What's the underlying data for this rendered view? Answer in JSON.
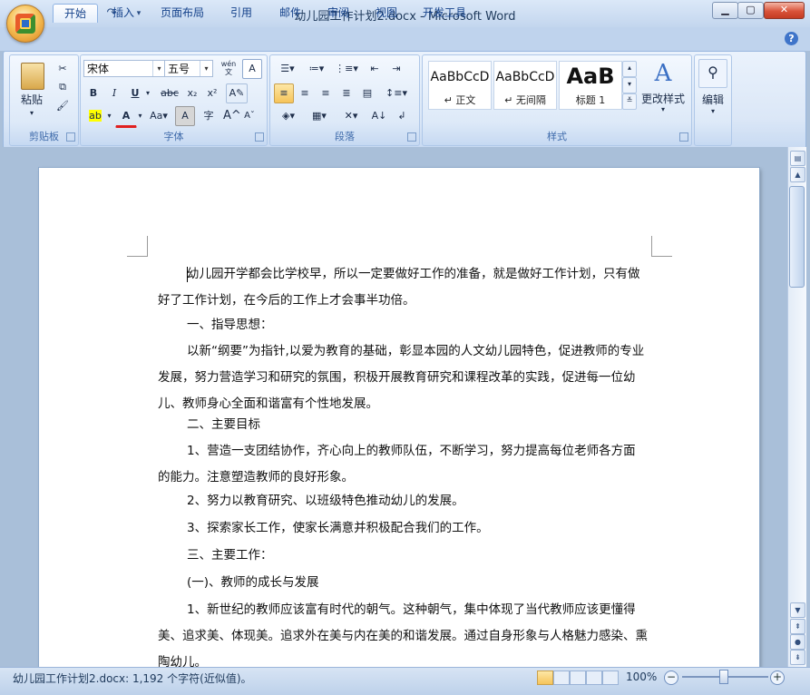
{
  "window": {
    "title": "幼儿园工作计划2.docx - Microsoft Word"
  },
  "tabs": [
    "开始",
    "插入",
    "页面布局",
    "引用",
    "邮件",
    "审阅",
    "视图",
    "开发工具"
  ],
  "ribbon": {
    "clipboard": {
      "label": "剪贴板",
      "paste": "粘贴"
    },
    "font": {
      "label": "字体",
      "font_name": "宋体",
      "font_size": "五号",
      "bold": "B",
      "italic": "I",
      "underline": "U",
      "strike": "abc",
      "subscript": "x₂",
      "superscript": "x²",
      "change_case": "Aa",
      "grow": "A",
      "shrink": "A",
      "char_border": "A",
      "phonetic": "wén",
      "enclose": "字"
    },
    "paragraph": {
      "label": "段落"
    },
    "styles": {
      "label": "样式",
      "items": [
        {
          "sample": "AaBbCcD",
          "name": "↵ 正文"
        },
        {
          "sample": "AaBbCcD",
          "name": "↵ 无间隔"
        },
        {
          "sample": "AaB",
          "name": "标题 1"
        }
      ],
      "change_styles": "更改样式"
    },
    "editing": {
      "label": "编辑"
    }
  },
  "document": {
    "paragraphs": [
      "幼儿园开学都会比学校早，所以一定要做好工作的准备，就是做好工作计划，只有做好了工作计划，在今后的工作上才会事半功倍。",
      "一、指导思想：",
      "以新“纲要”为指针,以爱为教育的基础，彰显本园的人文幼儿园特色，促进教师的专业发展，努力营造学习和研究的氛围，积极开展教育研究和课程改革的实践，促进每一位幼儿、教师身心全面和谐富有个性地发展。",
      "二、主要目标",
      "1、营造一支团结协作，齐心向上的教师队伍，不断学习，努力提高每位老师各方面的能力。注意塑造教师的良好形象。",
      "2、努力以教育研究、以班级特色推动幼儿的发展。",
      "3、探索家长工作，使家长满意并积极配合我们的工作。",
      "三、主要工作：",
      "(一)、教师的成长与发展",
      "1、新世纪的教师应该富有时代的朝气。这种朝气，集中体现了当代教师应该更懂得美、追求美、体现美。追求外在美与内在美的和谐发展。通过自身形象与人格魅力感染、熏陶幼儿。"
    ]
  },
  "status": {
    "text": "幼儿园工作计划2.docx: 1,192 个字符(近似值)。",
    "zoom": "100%"
  },
  "colors": {
    "accent": "#15428b",
    "ribbon_bg": "#dbe7f7",
    "doc_bg": "#a9bfd9"
  }
}
